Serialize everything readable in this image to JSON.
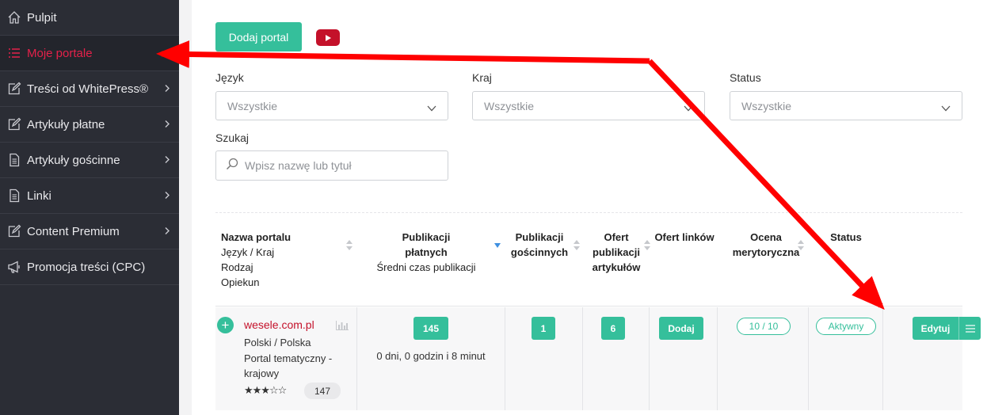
{
  "sidebar": {
    "items": [
      {
        "label": "Pulpit",
        "icon": "home-icon"
      },
      {
        "label": "Moje portale",
        "icon": "list-icon",
        "active": true
      },
      {
        "label": "Treści od WhitePress®",
        "icon": "edit-icon"
      },
      {
        "label": "Artykuły płatne",
        "icon": "edit-icon"
      },
      {
        "label": "Artykuły gościnne",
        "icon": "document-icon"
      },
      {
        "label": "Linki",
        "icon": "document-icon"
      },
      {
        "label": "Content Premium",
        "icon": "edit-icon"
      },
      {
        "label": "Promocja treści (CPC)",
        "icon": "megaphone-icon"
      }
    ]
  },
  "toolbar": {
    "add_label": "Dodaj portal",
    "video_icon": "youtube-icon"
  },
  "filters": {
    "language": {
      "label": "Język",
      "value": "Wszystkie"
    },
    "country": {
      "label": "Kraj",
      "value": "Wszystkie"
    },
    "status": {
      "label": "Status",
      "value": "Wszystkie"
    },
    "search": {
      "label": "Szukaj",
      "placeholder": "Wpisz nazwę lub tytuł"
    }
  },
  "table": {
    "headers": {
      "name": {
        "line1": "Nazwa portalu",
        "line2": "Język / Kraj",
        "line3": "Rodzaj",
        "line4": "Opiekun"
      },
      "paid": {
        "line1": "Publikacji",
        "line2": "płatnych",
        "sub": "Średni czas publikacji"
      },
      "guest": {
        "line1": "Publikacji",
        "line2": "gościnnych"
      },
      "offers": {
        "line1": "Ofert",
        "line2": "publikacji",
        "line3": "artykułów"
      },
      "links": {
        "line1": "Ofert linków"
      },
      "rating": {
        "line1": "Ocena",
        "line2": "merytoryczna"
      },
      "status": {
        "line1": "Status"
      }
    },
    "rows": [
      {
        "name": "wesele.com.pl",
        "lang_country": "Polski / Polska",
        "type_line1": "Portal tematyczny -",
        "type_line2": "krajowy",
        "stars": "★★★☆☆",
        "rating_count": "147",
        "paid": "145",
        "avg_time": "0 dni, 0 godzin i 8 minut",
        "guest": "1",
        "offers": "6",
        "links_action": "Dodaj",
        "rating": "10 / 10",
        "status": "Aktywny",
        "edit_label": "Edytuj"
      }
    ]
  },
  "colors": {
    "accent": "#35bf9b",
    "brand": "#c4112a",
    "active_nav": "#e4214a",
    "sidebar": "#2b2d35",
    "annotation": "#ff0000"
  }
}
